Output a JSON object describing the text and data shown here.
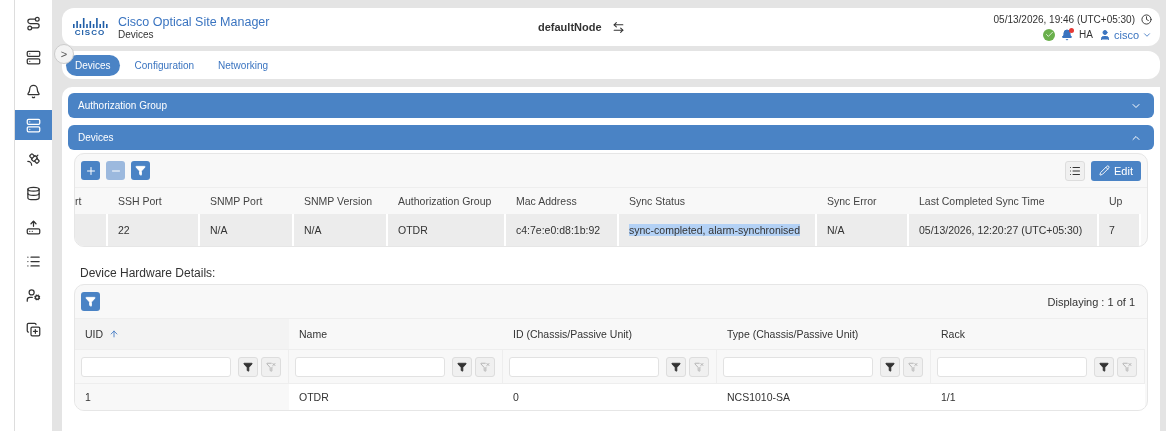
{
  "sidebar": {
    "items": [
      {
        "selected": false
      },
      {
        "selected": false
      },
      {
        "selected": false
      },
      {
        "selected": true
      },
      {
        "selected": false
      },
      {
        "selected": false
      },
      {
        "selected": false
      },
      {
        "selected": false
      },
      {
        "selected": false
      },
      {
        "selected": false
      }
    ],
    "toggle": ">"
  },
  "header": {
    "logo_text": "CISCO",
    "title": "Cisco Optical Site Manager",
    "subtitle": "Devices",
    "node": "defaultNode",
    "datetime": "05/13/2026, 19:46 (UTC+05:30)",
    "ha": "HA",
    "user": "cisco",
    "alarm": true
  },
  "tabs": [
    {
      "label": "Devices",
      "selected": true
    },
    {
      "label": "Configuration",
      "selected": false
    },
    {
      "label": "Networking",
      "selected": false
    }
  ],
  "accordions": [
    {
      "title": "Authorization Group",
      "expanded": false
    },
    {
      "title": "Devices",
      "expanded": true
    }
  ],
  "devices_toolbar": {
    "add_disabled": false,
    "remove_disabled": true,
    "edit": "Edit"
  },
  "devices_table": {
    "columns": [
      "rt",
      "SSH Port",
      "SNMP Port",
      "SNMP Version",
      "Authorization Group",
      "Mac Address",
      "Sync Status",
      "Sync Error",
      "Last Completed Sync Time",
      "Up"
    ],
    "rows": [
      [
        {
          "text": "",
          "highlighted": false
        },
        {
          "text": "22",
          "highlighted": false
        },
        {
          "text": "N/A",
          "highlighted": false
        },
        {
          "text": "N/A",
          "highlighted": false
        },
        {
          "text": "OTDR",
          "highlighted": false
        },
        {
          "text": "c4:7e:e0:d8:1b:92",
          "highlighted": false
        },
        {
          "text": "sync-completed, alarm-synchronised",
          "highlighted": true
        },
        {
          "text": "N/A",
          "highlighted": false
        },
        {
          "text": "05/13/2026, 12:20:27 (UTC+05:30)",
          "highlighted": false
        },
        {
          "text": "7",
          "highlighted": false
        }
      ]
    ]
  },
  "hardware": {
    "title": "Device Hardware Details:",
    "displaying": "Displaying : 1 of 1",
    "columns": [
      {
        "label": "UID",
        "sorted_ascending": true
      },
      {
        "label": "Name",
        "sorted_ascending": false
      },
      {
        "label": "ID (Chassis/Passive Unit)",
        "sorted_ascending": false
      },
      {
        "label": "Type (Chassis/Passive Unit)",
        "sorted_ascending": false
      },
      {
        "label": "Rack",
        "sorted_ascending": false
      }
    ],
    "rows": [
      [
        "1",
        "OTDR",
        "0",
        "NCS1010-SA",
        "1/1"
      ]
    ]
  }
}
